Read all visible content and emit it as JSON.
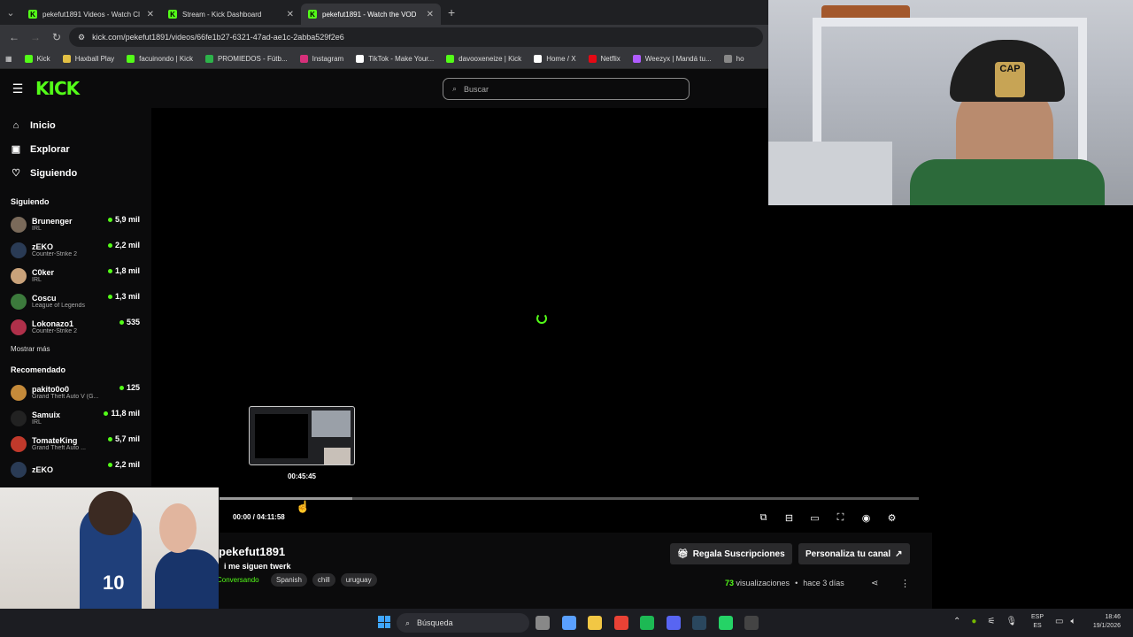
{
  "browser": {
    "tabs": [
      {
        "title": "pekefut1891 Videos - Watch Cl",
        "active": false
      },
      {
        "title": "Stream - Kick Dashboard",
        "active": false
      },
      {
        "title": "pekefut1891 - Watch the VOD",
        "active": true
      }
    ],
    "url": "kick.com/pekefut1891/videos/66fe1b27-6321-47ad-ae1c-2abba529f2e6",
    "bookmarks": [
      {
        "label": "Kick",
        "color": "#53fc18"
      },
      {
        "label": "Haxball Play",
        "color": "#e2c044"
      },
      {
        "label": "facuinondo | Kick",
        "color": "#53fc18"
      },
      {
        "label": "PROMIEDOS - Fútb...",
        "color": "#2db34a"
      },
      {
        "label": "Instagram",
        "color": "#d6307a"
      },
      {
        "label": "TikTok - Make Your...",
        "color": "#ffffff"
      },
      {
        "label": "davooxeneize | Kick",
        "color": "#53fc18"
      },
      {
        "label": "Home / X",
        "color": "#ffffff"
      },
      {
        "label": "Netflix",
        "color": "#e50914"
      },
      {
        "label": "Weezyx | Mandá tu...",
        "color": "#b05cff"
      },
      {
        "label": "ho",
        "color": "#888888"
      }
    ]
  },
  "header": {
    "logo": "KICK",
    "search_placeholder": "Buscar"
  },
  "sidebar": {
    "nav": [
      {
        "label": "Inicio",
        "icon": "home-icon",
        "glyph": "⌂"
      },
      {
        "label": "Explorar",
        "icon": "browse-icon",
        "glyph": "▣"
      },
      {
        "label": "Siguiendo",
        "icon": "heart-icon",
        "glyph": "♡"
      }
    ],
    "following_title": "Siguiendo",
    "following": [
      {
        "name": "Brunenger",
        "category": "IRL",
        "viewers": "5,9 mil",
        "color": "#7a6a5a"
      },
      {
        "name": "zEKO",
        "category": "Counter-Strike 2",
        "viewers": "2,2 mil",
        "color": "#2a3b55"
      },
      {
        "name": "C0ker",
        "category": "IRL",
        "viewers": "1,8 mil",
        "color": "#c9a27a"
      },
      {
        "name": "Coscu",
        "category": "League of Legends",
        "viewers": "1,3 mil",
        "color": "#3c7a3c"
      },
      {
        "name": "Lokonazo1",
        "category": "Counter-Strike 2",
        "viewers": "535",
        "color": "#b0304a"
      }
    ],
    "show_more": "Mostrar más",
    "recommended_title": "Recomendado",
    "recommended": [
      {
        "name": "pakito0o0",
        "category": "Grand Theft Auto V (G...",
        "viewers": "125",
        "color": "#c48a3a"
      },
      {
        "name": "Samuix",
        "category": "IRL",
        "viewers": "11,8 mil",
        "color": "#222222"
      },
      {
        "name": "TomateKing",
        "category": "Grand Theft Auto ...",
        "viewers": "5,7 mil",
        "color": "#c0392b"
      },
      {
        "name": "zEKO",
        "category": "",
        "viewers": "2,2 mil",
        "color": "#2a3b55"
      }
    ]
  },
  "player": {
    "hover_time": "00:45:45",
    "time": "00:00 / 04:11:58",
    "progress_buffered": 0.19,
    "controls": [
      {
        "name": "miniplayer-icon",
        "glyph": "⧉"
      },
      {
        "name": "clip-icon",
        "glyph": "⊟"
      },
      {
        "name": "theater-icon",
        "glyph": "▭"
      },
      {
        "name": "fullscreen-icon",
        "glyph": "⛶"
      },
      {
        "name": "speed-icon",
        "glyph": "◉"
      },
      {
        "name": "settings-icon",
        "glyph": "⚙"
      }
    ]
  },
  "video": {
    "channel": "pekefut1891",
    "title": "i me siguen twerk",
    "category": "Conversando",
    "tags": [
      "Spanish",
      "chill",
      "uruguay"
    ],
    "gift_button": "Regala Suscripciones",
    "customize_button": "Personaliza tu canal",
    "views_count": "73",
    "views_label": "visualizaciones",
    "time_ago": "hace 3 días"
  },
  "webcam": {
    "cap_text": "CAP"
  },
  "overlay": {
    "jersey_number": "10"
  },
  "taskbar": {
    "search_label": "Búsqueda",
    "apps": [
      {
        "name": "task-view-icon",
        "color": "#888888"
      },
      {
        "name": "copilot-icon",
        "color": "#5aa0ff"
      },
      {
        "name": "file-explorer-icon",
        "color": "#f2c744"
      },
      {
        "name": "chrome-icon",
        "color": "#e94235"
      },
      {
        "name": "spotify-icon",
        "color": "#1db954"
      },
      {
        "name": "discord-icon",
        "color": "#5865f2"
      },
      {
        "name": "steam-icon",
        "color": "#2a475e"
      },
      {
        "name": "whatsapp-icon",
        "color": "#25d366"
      },
      {
        "name": "obs-icon",
        "color": "#444444"
      }
    ],
    "lang_top": "ESP",
    "lang_bottom": "ES",
    "time": "18:46",
    "date": "19/1/2026"
  }
}
